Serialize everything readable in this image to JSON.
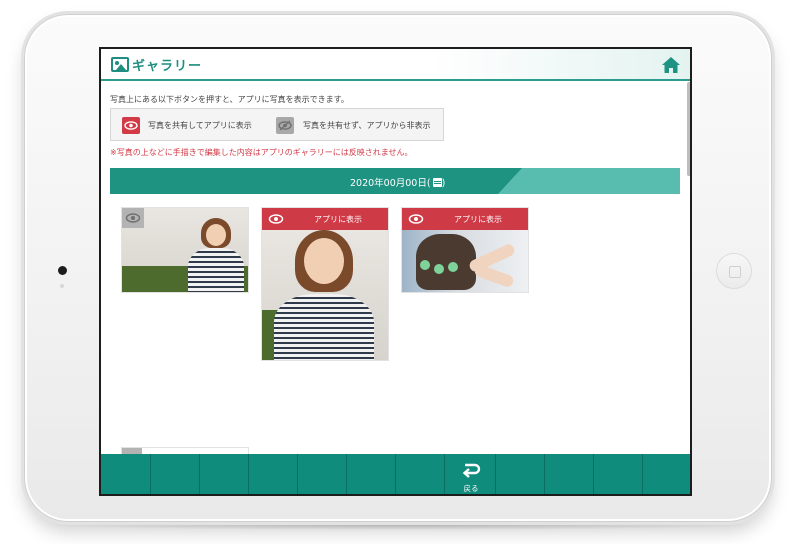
{
  "header": {
    "title": "ギャラリー"
  },
  "intro": "写真上にある以下ボタンを押すと、アプリに写真を表示できます。",
  "legend": {
    "show_label": "写真を共有してアプリに表示",
    "hide_label": "写真を共有せず、アプリから非表示"
  },
  "note": "※写真の上などに手描きで編集した内容はアプリのギャラリーには反映されません。",
  "date_bar": {
    "date": "2020年00月00日(",
    "date_suffix": ")"
  },
  "photos": [
    {
      "shown": false,
      "label": ""
    },
    {
      "shown": true,
      "label": "アプリに表示"
    },
    {
      "shown": true,
      "label": "アプリに表示"
    }
  ],
  "footer": {
    "back_label": "戻る"
  },
  "colors": {
    "accent": "#1f8e80",
    "footer": "#0f8c7c",
    "show_red": "#cf3a47",
    "hide_gray": "#b3b3b3"
  },
  "icons": [
    "gallery-icon",
    "home-icon",
    "eye-icon",
    "calendar-icon",
    "back-arrow-icon"
  ]
}
